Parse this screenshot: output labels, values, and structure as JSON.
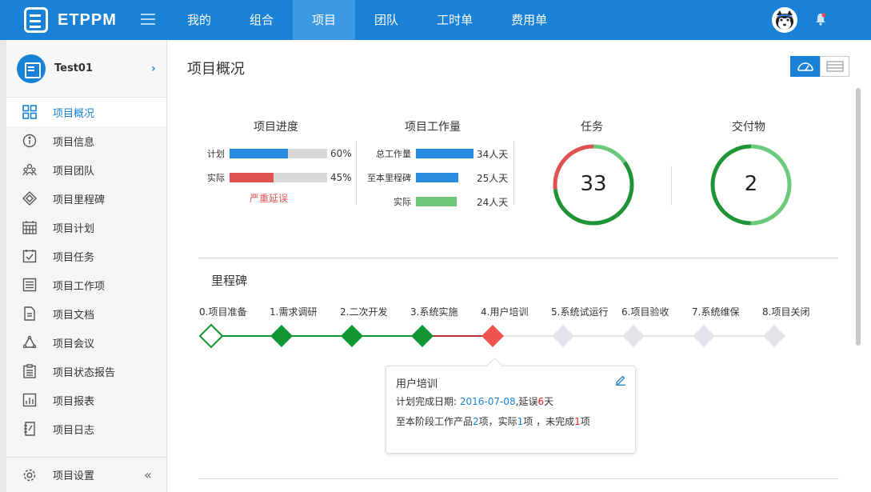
{
  "app": {
    "logo_text": "ETPPM"
  },
  "nav": [
    {
      "label": "我的"
    },
    {
      "label": "组合"
    },
    {
      "label": "项目"
    },
    {
      "label": "团队"
    },
    {
      "label": "工时单"
    },
    {
      "label": "费用单"
    }
  ],
  "sidebar": {
    "project_name": "Test01",
    "items": [
      {
        "label": "项目概况",
        "icon": "grid-icon"
      },
      {
        "label": "项目信息",
        "icon": "info-icon"
      },
      {
        "label": "项目团队",
        "icon": "team-icon"
      },
      {
        "label": "项目里程碑",
        "icon": "milestone-icon"
      },
      {
        "label": "项目计划",
        "icon": "calendar-icon"
      },
      {
        "label": "项目任务",
        "icon": "task-icon"
      },
      {
        "label": "项目工作项",
        "icon": "list-icon"
      },
      {
        "label": "项目文档",
        "icon": "document-icon"
      },
      {
        "label": "项目会议",
        "icon": "meeting-icon"
      },
      {
        "label": "项目状态报告",
        "icon": "report-icon"
      },
      {
        "label": "项目报表",
        "icon": "chart-icon"
      },
      {
        "label": "项目日志",
        "icon": "log-icon"
      }
    ],
    "settings_label": "项目设置"
  },
  "main": {
    "title": "项目概况",
    "progress": {
      "title": "项目进度",
      "rows": [
        {
          "label": "计划",
          "percent": 60,
          "value_text": "60%",
          "color": "#2a8ce0"
        },
        {
          "label": "实际",
          "percent": 45,
          "value_text": "45%",
          "color": "#e05252"
        }
      ],
      "status": "严重延误"
    },
    "workload": {
      "title": "项目工作量",
      "max": 34,
      "rows": [
        {
          "label": "总工作量",
          "value": 34,
          "value_text": "34人天",
          "color": "#2a8ce0"
        },
        {
          "label": "至本里程碑",
          "value": 25,
          "value_text": "25人天",
          "color": "#2a8ce0"
        },
        {
          "label": "实际",
          "value": 24,
          "value_text": "24人天",
          "color": "#6cc97a"
        }
      ]
    },
    "tasks": {
      "title": "任务",
      "count": "33",
      "segments": [
        {
          "fraction": 0.15,
          "color": "#6cc97a"
        },
        {
          "fraction": 0.58,
          "color": "#1e9436"
        },
        {
          "fraction": 0.27,
          "color": "#e05252"
        }
      ]
    },
    "deliverables": {
      "title": "交付物",
      "count": "2",
      "segments": [
        {
          "fraction": 0.5,
          "color": "#6cc97a"
        },
        {
          "fraction": 0.5,
          "color": "#1e9436"
        }
      ]
    },
    "milestones": {
      "title": "里程碑",
      "items": [
        {
          "label": "0.项目准备",
          "status": "start"
        },
        {
          "label": "1.需求调研",
          "status": "done"
        },
        {
          "label": "2.二次开发",
          "status": "done"
        },
        {
          "label": "3.系统实施",
          "status": "done"
        },
        {
          "label": "4.用户培训",
          "status": "delayed"
        },
        {
          "label": "5.系统试运行",
          "status": "pending"
        },
        {
          "label": "6.项目验收",
          "status": "pending"
        },
        {
          "label": "7.系统维保",
          "status": "pending"
        },
        {
          "label": "8.项目关闭",
          "status": "pending"
        }
      ],
      "colors": {
        "done": "#129632",
        "delayed": "#ef5350",
        "pending": "#e2e4e8",
        "start": "#129632"
      }
    },
    "popup": {
      "title": "用户培训",
      "plan_label": "计划完成日期:",
      "plan_date": "2016-07-08",
      "delay_prefix": ",延误",
      "delay_days": "6",
      "delay_suffix": "天",
      "products_prefix": "至本阶段工作产品",
      "products_total": "2",
      "products_mid1": "项，实际",
      "products_actual": "1",
      "products_mid2": "项 ，未完成",
      "products_incomplete": "1",
      "products_suffix": "项"
    }
  }
}
